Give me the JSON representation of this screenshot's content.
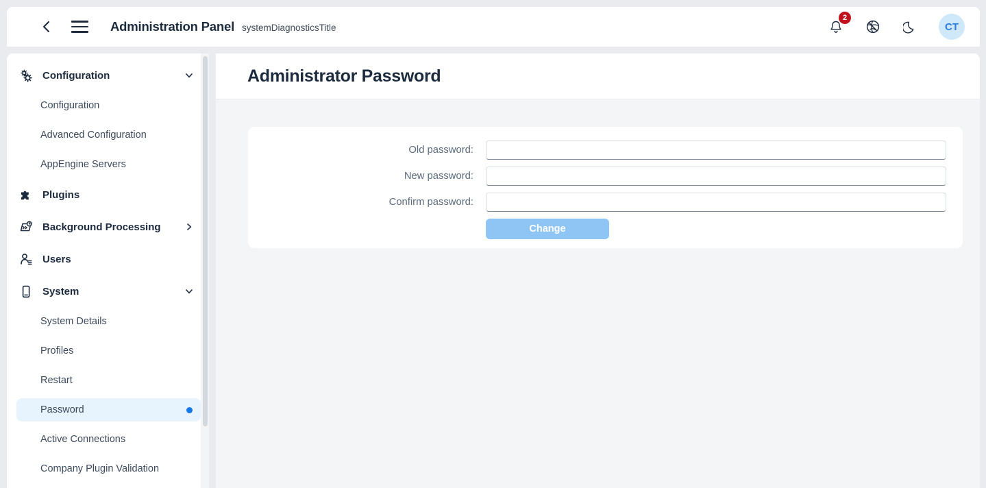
{
  "header": {
    "back_icon": "chevron-left-icon",
    "menu_icon": "hamburger-menu-icon",
    "title": "Administration Panel",
    "subtitle": "systemDiagnosticsTitle",
    "notifications": {
      "icon": "bell-icon",
      "badge_count": "2",
      "badge_color": "#c1121f"
    },
    "language_icon": "globe-icon",
    "theme_icon": "moon-icon",
    "avatar": {
      "initials": "CT",
      "bg_color": "#cfe8fa",
      "text_color": "#2a7de1"
    }
  },
  "sidebar": {
    "groups": [
      {
        "label": "Configuration",
        "icon": "gears-icon",
        "chevron": "chevron-down-icon",
        "expanded": true
      },
      {
        "label": "Plugins",
        "icon": "puzzle-piece-icon",
        "chevron": "",
        "expanded": false
      },
      {
        "label": "Background Processing",
        "icon": "batch-processing-icon",
        "chevron": "chevron-right-icon",
        "expanded": false
      },
      {
        "label": "Users",
        "icon": "user-list-icon",
        "chevron": "",
        "expanded": false
      },
      {
        "label": "System",
        "icon": "device-icon",
        "chevron": "chevron-down-icon",
        "expanded": true
      }
    ],
    "configuration_items": [
      {
        "label": "Configuration"
      },
      {
        "label": "Advanced Configuration"
      },
      {
        "label": "AppEngine Servers"
      }
    ],
    "system_items": [
      {
        "label": "System Details",
        "active": false
      },
      {
        "label": "Profiles",
        "active": false
      },
      {
        "label": "Restart",
        "active": false
      },
      {
        "label": "Password",
        "active": true,
        "indicator_color": "#1677e8"
      },
      {
        "label": "Active Connections",
        "active": false
      },
      {
        "label": "Company Plugin Validation",
        "active": false
      }
    ],
    "active_bg_color": "#e8f4fd"
  },
  "main": {
    "page_title": "Administrator Password",
    "form": {
      "fields": [
        {
          "label": "Old password:",
          "value": "",
          "placeholder": "",
          "name": "old-password-field"
        },
        {
          "label": "New password:",
          "value": "",
          "placeholder": "",
          "name": "new-password-field"
        },
        {
          "label": "Confirm password:",
          "value": "",
          "placeholder": "",
          "name": "confirm-password-field"
        }
      ],
      "submit_label": "Change",
      "submit_color": "#8ec5f5"
    }
  }
}
